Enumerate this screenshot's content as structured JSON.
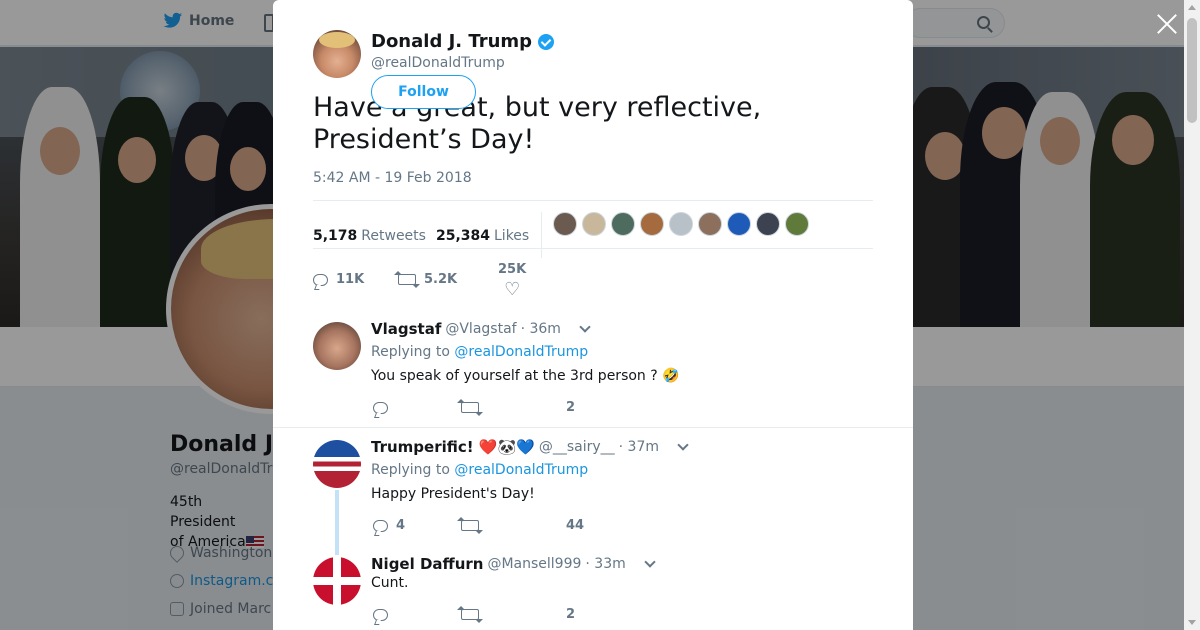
{
  "background": {
    "nav": {
      "home_label": "Home"
    },
    "profile": {
      "name": "Donald J.",
      "handle": "@realDonaldTr",
      "bio_line1": "45th President",
      "bio_line2": "of America",
      "location": "Washington",
      "link": "Instagram.c",
      "joined": "Joined Marc"
    }
  },
  "tweet": {
    "author_name": "Donald J. Trump",
    "author_handle": "@realDonaldTrump",
    "follow_label": "Follow",
    "text": "Have a great, but very reflective, President’s Day!",
    "timestamp": "5:42 AM - 19 Feb 2018",
    "retweets_count": "5,178",
    "retweets_label": "Retweets",
    "likes_count": "25,384",
    "likes_label": "Likes",
    "actions": {
      "replies": "11K",
      "retweets": "5.2K",
      "likes": "25K"
    },
    "liker_colors": [
      "#6b5a4f",
      "#c9b79c",
      "#4d6b5f",
      "#a56a3d",
      "#b8c0c8",
      "#8c6f5c",
      "#1e5bb8",
      "#3c4250",
      "#5f7a3a"
    ]
  },
  "replies": [
    {
      "name": "Vlagstaf",
      "handle": "@Vlagstaf",
      "time": "· 36m",
      "replying_prefix": "Replying to",
      "replying_to": "@realDonaldTrump",
      "text": "You speak of yourself at the 3rd person ? 🤣",
      "reply_count": "",
      "retweet_count": "",
      "like_count": "2"
    },
    {
      "name": "Trumperific! ❤️🐼💙",
      "handle": "@__sairy__",
      "time": "· 37m",
      "replying_prefix": "Replying to",
      "replying_to": "@realDonaldTrump",
      "text": "Happy President's Day!",
      "reply_count": "4",
      "retweet_count": "",
      "like_count": "44"
    },
    {
      "name": "Nigel Daffurn",
      "handle": "@Mansell999",
      "time": "· 33m",
      "text": "Cunt.",
      "reply_count": "",
      "retweet_count": "",
      "like_count": "2"
    }
  ],
  "colors": {
    "accent": "#1da1f2",
    "link": "#1b95e0",
    "muted": "#657786"
  }
}
